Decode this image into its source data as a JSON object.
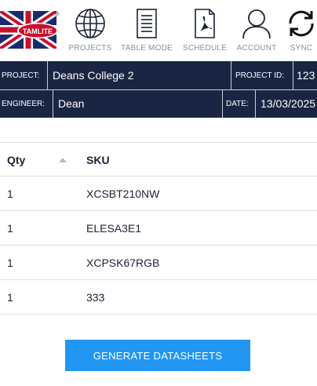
{
  "brand": {
    "logo_text": "TAMLITE",
    "registered_mark": "®"
  },
  "nav": [
    {
      "label": "PROJECTS",
      "icon": "globe-icon"
    },
    {
      "label": "TABLE MODE",
      "icon": "document-icon"
    },
    {
      "label": "SCHEDULE",
      "icon": "pdf-icon"
    },
    {
      "label": "ACCOUNT",
      "icon": "user-icon"
    },
    {
      "label": "SYNC",
      "icon": "sync-icon"
    }
  ],
  "info": {
    "project_label": "PROJECT:",
    "project_value": "Deans College 2",
    "project_id_label": "PROJECT ID:",
    "project_id_value": "123",
    "engineer_label": "ENGINEER:",
    "engineer_value": "Dean",
    "date_label": "DATE:",
    "date_value": "13/03/2025"
  },
  "table": {
    "columns": {
      "qty": "Qty",
      "sku": "SKU"
    },
    "sort": "ascending",
    "rows": [
      {
        "qty": "1",
        "sku": "XCSBT210NW"
      },
      {
        "qty": "1",
        "sku": "ELESA3E1"
      },
      {
        "qty": "1",
        "sku": "XCPSK67RGB"
      },
      {
        "qty": "1",
        "sku": "333"
      }
    ]
  },
  "actions": {
    "generate_label": "GENERATE DATASHEETS"
  },
  "colors": {
    "navy": "#1a2544",
    "accent": "#2196f3",
    "brand_red": "#c8102e"
  }
}
